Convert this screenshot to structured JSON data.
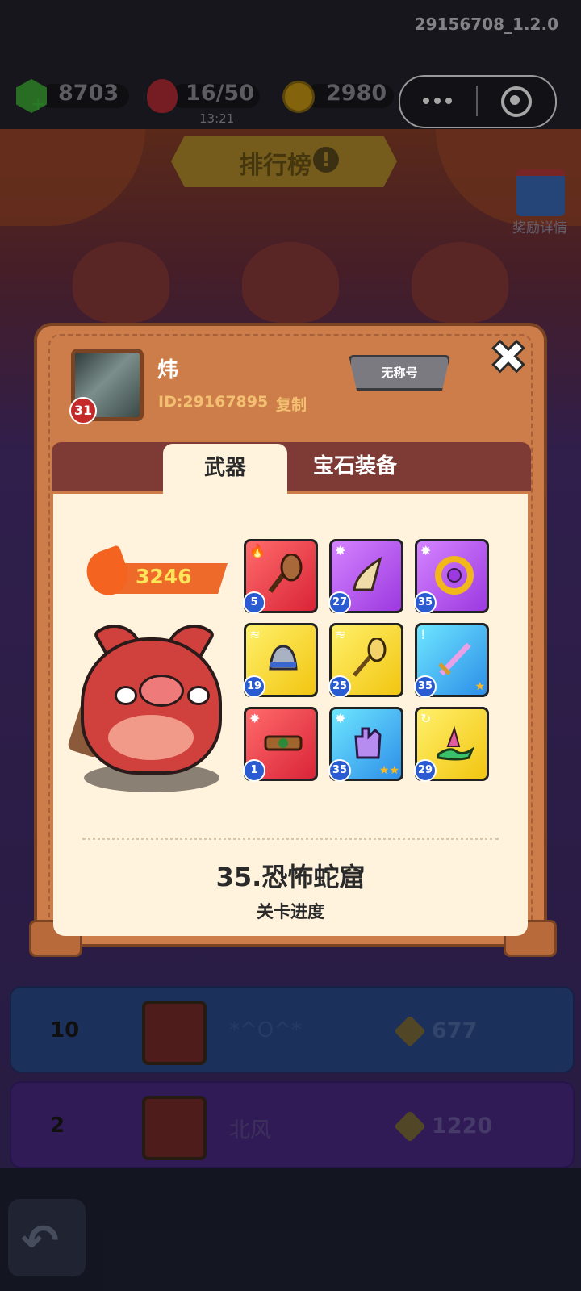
{
  "version": "29156708_1.2.0",
  "currencies": {
    "gems": "8703",
    "stamina": "16/50",
    "stamina_timer": "13:21",
    "coins": "2980"
  },
  "leaderboard": {
    "title": "排行榜",
    "info_mark": "!",
    "reward_label": "奖励详情",
    "rows": [
      {
        "rank": "10",
        "name": "*^O^*",
        "score": "677"
      },
      {
        "rank": "2",
        "name": "北风",
        "score": "1220"
      }
    ]
  },
  "profile": {
    "name": "炜",
    "level": "31",
    "id_text": "ID:29167895",
    "copy_label": "复制",
    "title_badge": "无称号",
    "close_glyph": "✖"
  },
  "tabs": [
    {
      "label": "武器",
      "active": true
    },
    {
      "label": "宝石装备",
      "active": false
    }
  ],
  "power": "3246",
  "equipment": [
    {
      "name": "leaf-broom",
      "level": "5",
      "color": "red",
      "stars": 0
    },
    {
      "name": "horn",
      "level": "27",
      "color": "purple",
      "stars": 0
    },
    {
      "name": "gold-ring",
      "level": "35",
      "color": "purple",
      "stars": 0
    },
    {
      "name": "bell",
      "level": "19",
      "color": "yellow",
      "stars": 0
    },
    {
      "name": "feather-staff",
      "level": "25",
      "color": "yellow",
      "stars": 0
    },
    {
      "name": "sword",
      "level": "35",
      "color": "blue",
      "stars": 1
    },
    {
      "name": "belt",
      "level": "1",
      "color": "red",
      "stars": 0
    },
    {
      "name": "glove",
      "level": "35",
      "color": "blue",
      "stars": 2
    },
    {
      "name": "dragon",
      "level": "29",
      "color": "yellow",
      "stars": 0
    }
  ],
  "stage": {
    "name": "35.恐怖蛇窟",
    "caption": "关卡进度"
  },
  "colors": {
    "panel": "#cc7d4a",
    "content": "#fff3dd",
    "accent_orange": "#ee6a2a",
    "id_text": "#f3c071"
  }
}
